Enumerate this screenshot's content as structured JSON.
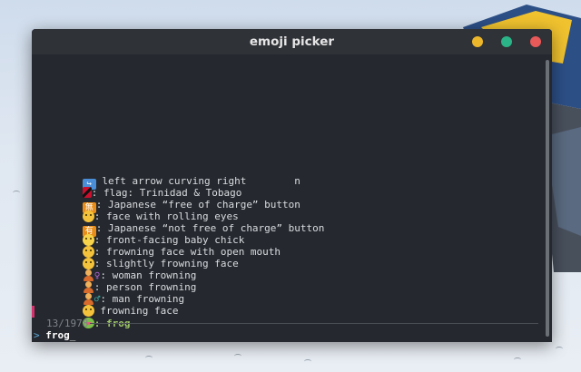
{
  "window": {
    "title": "emoji picker"
  },
  "results": [
    {
      "icon": "left-arrow-curving-right-icon",
      "glyph": "↪",
      "prefix": "",
      "text": " left arrow curving right        n"
    },
    {
      "icon": "flag-trinidad-tobago-icon",
      "glyph": "",
      "prefix": "",
      "text": ": flag: Trinidad & Tobago"
    },
    {
      "icon": "japanese-free-of-charge-icon",
      "glyph": "無",
      "prefix": "",
      "text": ": Japanese “free of charge” button"
    },
    {
      "icon": "face-with-rolling-eyes-icon",
      "glyph": "",
      "prefix": "",
      "text": ": face with rolling eyes"
    },
    {
      "icon": "japanese-not-free-of-charge-icon",
      "glyph": "有",
      "prefix": "",
      "text": ": Japanese “not free of charge” button"
    },
    {
      "icon": "front-facing-baby-chick-icon",
      "glyph": "",
      "prefix": "",
      "text": ": front-facing baby chick"
    },
    {
      "icon": "frowning-face-open-mouth-icon",
      "glyph": "",
      "prefix": "",
      "text": ": frowning face with open mouth"
    },
    {
      "icon": "slightly-frowning-face-icon",
      "glyph": "",
      "prefix": "",
      "text": ": slightly frowning face"
    },
    {
      "icon": "woman-frowning-icon",
      "glyph": "♀",
      "prefix": "",
      "text": ": woman frowning"
    },
    {
      "icon": "person-frowning-icon",
      "glyph": "",
      "prefix": "",
      "text": ": person frowning"
    },
    {
      "icon": "man-frowning-icon",
      "glyph": "♂",
      "prefix": "",
      "text": ": man frowning"
    },
    {
      "icon": "frowning-face-icon",
      "glyph": "",
      "prefix": "",
      "text": " frowning face"
    }
  ],
  "selected": {
    "icon": "frog-icon",
    "text": ": frog"
  },
  "counter": "13/1978",
  "prompt": {
    "symbol": ">",
    "query": "frog"
  },
  "colors": {
    "accent": "#d6306e",
    "match": "#9ec66a",
    "prompt": "#5fa8d6"
  }
}
